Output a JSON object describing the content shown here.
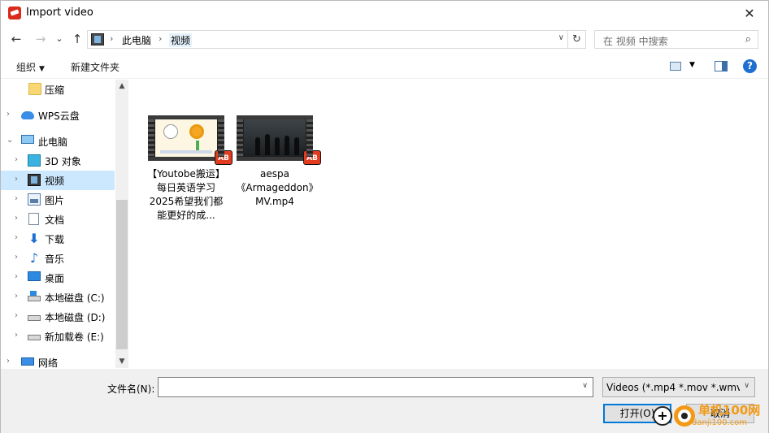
{
  "window": {
    "title": "Import video",
    "close_glyph": "✕"
  },
  "nav": {
    "back": "←",
    "forward": "→",
    "recent": "⌄",
    "up": "↑",
    "breadcrumb": [
      "此电脑",
      "视频"
    ],
    "crumb_sep": "›",
    "dropdown": "∨",
    "refresh": "↻"
  },
  "search": {
    "placeholder": "在 视频 中搜索",
    "icon": "⌕"
  },
  "toolbar": {
    "organize": "组织",
    "new_folder": "新建文件夹",
    "arrow": "▼",
    "help": "?"
  },
  "tree": {
    "items": [
      {
        "label": "压缩",
        "icon": "folder-icon"
      },
      {
        "label": "WPS云盘",
        "icon": "cloud-icon"
      },
      {
        "label": "此电脑",
        "icon": "computer-icon"
      },
      {
        "label": "3D 对象",
        "icon": "cube-icon"
      },
      {
        "label": "视频",
        "icon": "video-folder-icon"
      },
      {
        "label": "图片",
        "icon": "pictures-icon"
      },
      {
        "label": "文档",
        "icon": "documents-icon"
      },
      {
        "label": "下载",
        "icon": "download-icon"
      },
      {
        "label": "音乐",
        "icon": "music-icon"
      },
      {
        "label": "桌面",
        "icon": "desktop-icon"
      },
      {
        "label": "本地磁盘 (C:)",
        "icon": "system-drive-icon"
      },
      {
        "label": "本地磁盘 (D:)",
        "icon": "drive-icon"
      },
      {
        "label": "新加载卷 (E:)",
        "icon": "drive-icon"
      },
      {
        "label": "网络",
        "icon": "network-icon"
      }
    ],
    "chev_right": "›",
    "chev_down": "⌄"
  },
  "scroll": {
    "up": "▲",
    "down": "▼"
  },
  "files": [
    {
      "name": "【Youtobe搬运】每日英语学习2025希望我们都能更好的成...",
      "badge": "AB"
    },
    {
      "name": "aespa《Armageddon》MV.mp4",
      "badge": "AB"
    }
  ],
  "bottom": {
    "filename_label": "文件名(N):",
    "filename_value": "",
    "filetype": "Videos (*.mp4 *.mov *.wmv *",
    "open_label": "打开(O)",
    "cancel_label": "取消",
    "arrow": "∨"
  },
  "watermark": {
    "text": "单机100网",
    "sub": "danji100.com"
  }
}
